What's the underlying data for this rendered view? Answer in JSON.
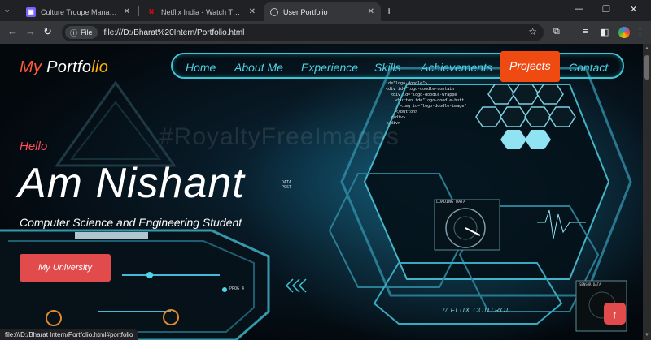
{
  "browser": {
    "tabs": [
      {
        "title": "Culture Troupe Management Sy",
        "favicon": "app-favicon"
      },
      {
        "title": "Netflix India - Watch TV Shows",
        "favicon": "netflix-favicon"
      },
      {
        "title": "User Portfolio",
        "favicon": "globe-favicon",
        "active": true
      }
    ],
    "new_tab": "+",
    "address": {
      "chip": "File",
      "url": "file:///D:/Bharat%20Intern/Portfolio.html"
    },
    "status_url": "file:///D:/Bharat Intern/Portfolio.html#portfolio"
  },
  "site": {
    "logo": {
      "my": "My",
      "port": "Portfo",
      "lio": "lio"
    },
    "nav": [
      {
        "label": "Home"
      },
      {
        "label": "About Me"
      },
      {
        "label": "Experience"
      },
      {
        "label": "Skills"
      },
      {
        "label": "Achievements"
      },
      {
        "label": "Projects",
        "active": true
      },
      {
        "label": "Contact"
      }
    ],
    "hero": {
      "hello": "Hello",
      "headline": "Am Nishant",
      "subtitle": "Computer Science and Engineering Student",
      "button": "My University"
    },
    "art": {
      "watermark": "#RoyaltyFreeImages",
      "code_snippet": "id=\"logo-doodle\">\n<div id=\"logo-doodle-contain\n  <div id=\"logo-doodle-wrappe\n    <button id=\"logo-doodle-butt\n      <img id=\"logo-doodle-image\"\n    </button>\n  </div>\n</div>",
      "loading_label": "LOADING DATA",
      "flux_label": "// FLUX CONTROL",
      "sensor_label": "SENSOR DATA",
      "data_label": "DATA\nPOST",
      "prog_label": "PROG 4"
    },
    "to_top": "↑"
  },
  "colors": {
    "accent": "#3dc5d6",
    "active_nav": "#f04a13",
    "button": "#e24b4b",
    "hello": "#ff4d57"
  }
}
